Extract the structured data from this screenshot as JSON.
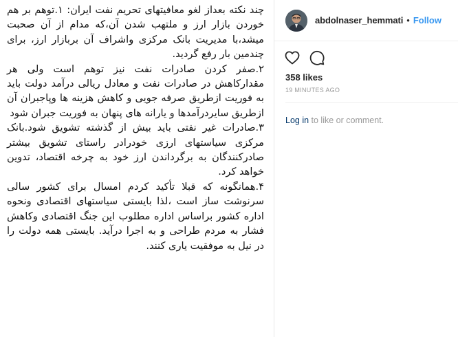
{
  "post": {
    "paragraphs": [
      "چند نکته بعداز لغو معافیتهای تحریم نفت ایران: ۱.توهم بر هم خوردن بازار ارز و ملتهب شدن آن،که مدام از آن صحبت میشد،با مدیریت بانک مرکزی واشراف آن بربازار ارز، برای چندمین بار رفع گردید.",
      "۲.صفر کردن صادرات نفت نیز توهم است ولی هر مقدارکاهش در صادرات نفت و معادل ریالی درآمد دولت باید به فوریت ازطریق صرفه جویی و کاهش هزینه ها وپاجبران آن ازطریق سایردرآمدها و یارانه های پنهان به فوریت جبران شود",
      "۳.صادرات غیر نفتی باید  بیش از گذشته تشویق شود.بانک مرکزی سیاستهای ارزی خودرادر راستای تشویق بیشتر صادرکنندگان به برگرداندن ارز خود به چرخه اقتصاد، تدوین خواهد کرد.",
      "۴.همانگونه که قبلا تأکید کردم امسال برای کشور سالی سرنوشت ساز است ،لذا بایستی سیاستهای اقتصادی ونحوه اداره کشور  براساس اداره مطلوب این جنگ اقتصادی وکاهش فشار به مردم  طراحی و به اجرا درآید. بایستی همه دولت را در نیل به موفقیت یاری کنند."
    ]
  },
  "header": {
    "username": "abdolnaser_hemmati",
    "separator": "•",
    "follow_label": "Follow"
  },
  "stats": {
    "likes": "358 likes",
    "time": "19 MINUTES AGO"
  },
  "login": {
    "link": "Log in",
    "text": " to like or comment."
  },
  "icons": {
    "like": "heart-icon",
    "comment": "comment-icon",
    "avatar": "avatar"
  },
  "colors": {
    "follow": "#3897f0",
    "link": "#003569",
    "muted": "#999999"
  }
}
